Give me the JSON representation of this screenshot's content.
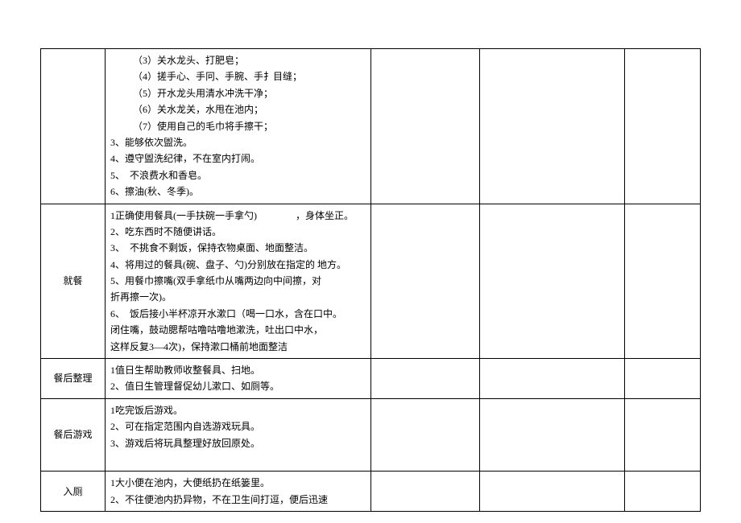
{
  "rows": [
    {
      "label": "",
      "content": [
        "（3）关水龙头、打肥皂；",
        "（4）搓手心、手冋、手腕、手扌目缝；",
        "（5）开水龙头用清水冲洗干净；",
        "（6）关水龙关，水甩在池内；",
        "（7）使用自己的毛巾将手擦干；",
        "3、能够依次盥洗。",
        "4、遵守盥洗纪律，不在室内打闹。",
        "5、　不浪费水和香皂。",
        "6、擦油(秋、冬季)。"
      ],
      "indented": [
        0,
        1,
        2,
        3,
        4
      ]
    },
    {
      "label": "就餐",
      "content": [
        "1正确使用餐具(一手扶碗一手拿勺)　　　　，身体坐正。",
        "2、吃东西时不随便讲话。",
        "3、　不挑食不剩饭，保持衣物桌面、地面整洁。",
        "4、将用过的餐具(碗、盘子、勺)分别放在指定的 地方。",
        "5、用餐巾擦嘴(双手拿纸巾从嘴两边向中间擦，对",
        "折再擦一次)。",
        "6、　饭后接小半杯凉开水漱口（喝一口水，含在口中。",
        "闭住嘴，鼓动腮帮咕噜咕噜地漱洗，吐出口中水，",
        "这样反复3—4次)，保持漱口桶前地面整洁"
      ],
      "indented": []
    },
    {
      "label": "餐后整理",
      "content": [
        "1值日生帮助教师收整餐具、扫地。",
        "2、值日生管理督促幼儿漱口、如厕等。"
      ],
      "indented": []
    },
    {
      "label": "餐后游戏",
      "content": [
        "1吃完饭后游戏。",
        "2、可在指定范围内自选游戏玩具。",
        "3、游戏后将玩具整理好放回原处。",
        ""
      ],
      "indented": []
    },
    {
      "label": "入厕",
      "content": [
        "1大小便在池内，大便纸扔在纸篓里。",
        "2、不往便池内扔异物，不在卫生间打逗，便后迅速"
      ],
      "indented": []
    }
  ]
}
